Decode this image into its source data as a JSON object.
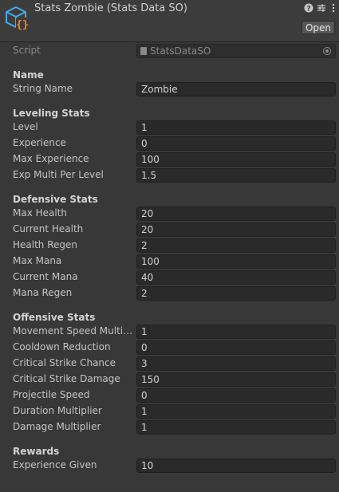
{
  "header": {
    "title": "Stats Zombie (Stats Data SO)",
    "open_label": "Open",
    "icons": [
      "scriptable-object-icon",
      "help-icon",
      "presets-icon",
      "kebab-menu-icon"
    ]
  },
  "script": {
    "label": "Script",
    "value": "StatsDataSO"
  },
  "sections": {
    "name": {
      "title": "Name",
      "string_name": {
        "label": "String Name",
        "value": "Zombie"
      }
    },
    "leveling": {
      "title": "Leveling Stats",
      "level": {
        "label": "Level",
        "value": "1"
      },
      "experience": {
        "label": "Experience",
        "value": "0"
      },
      "max_experience": {
        "label": "Max Experience",
        "value": "100"
      },
      "exp_multi": {
        "label": "Exp Multi Per Level",
        "value": "1.5"
      }
    },
    "defensive": {
      "title": "Defensive Stats",
      "max_health": {
        "label": "Max Health",
        "value": "20"
      },
      "current_health": {
        "label": "Current Health",
        "value": "20"
      },
      "health_regen": {
        "label": "Health Regen",
        "value": "2"
      },
      "max_mana": {
        "label": "Max Mana",
        "value": "100"
      },
      "current_mana": {
        "label": "Current Mana",
        "value": "40"
      },
      "mana_regen": {
        "label": "Mana Regen",
        "value": "2"
      }
    },
    "offensive": {
      "title": "Offensive Stats",
      "movement_speed": {
        "label": "Movement Speed Multipl...",
        "value": "1"
      },
      "cooldown_reduction": {
        "label": "Cooldown Reduction",
        "value": "0"
      },
      "crit_chance": {
        "label": "Critical Strike Chance",
        "value": "3"
      },
      "crit_damage": {
        "label": "Critical Strike Damage",
        "value": "150"
      },
      "projectile_speed": {
        "label": "Projectile Speed",
        "value": "0"
      },
      "duration_multiplier": {
        "label": "Duration Multiplier",
        "value": "1"
      },
      "damage_multiplier": {
        "label": "Damage Multiplier",
        "value": "1"
      }
    },
    "rewards": {
      "title": "Rewards",
      "experience_given": {
        "label": "Experience Given",
        "value": "10"
      }
    }
  }
}
